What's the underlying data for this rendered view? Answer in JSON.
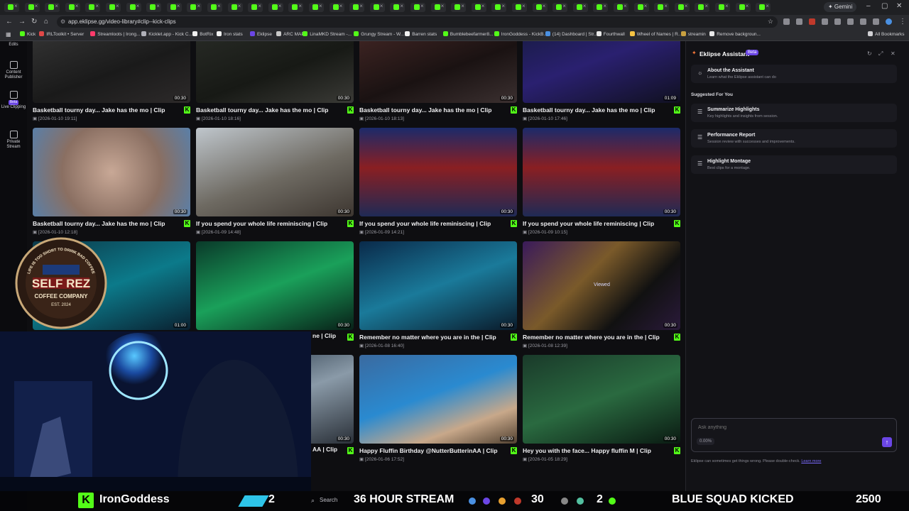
{
  "browser": {
    "tab_count": 38,
    "gemini_label": "✦ Gemini",
    "url": "app.eklipse.gg/video-library#clip--kick-clips",
    "bookmarks": [
      {
        "label": "Kick",
        "color": "#53fc18"
      },
      {
        "label": "IRLToolkit • Server",
        "color": "#e04848"
      },
      {
        "label": "Streamloots | Irong...",
        "color": "#ff3b6b"
      },
      {
        "label": "Kicklet.app - Kick C...",
        "color": "#b0b0b8"
      },
      {
        "label": "BotRix",
        "color": "#f0f0f0"
      },
      {
        "label": "Iron stats",
        "color": "#f0f0f0"
      },
      {
        "label": "Eklipse",
        "color": "#6b46e5"
      },
      {
        "label": "ARC MAP",
        "color": "#c8c8c8"
      },
      {
        "label": "LinaMKD Stream -...",
        "color": "#53fc18"
      },
      {
        "label": "Grungy Stream - W...",
        "color": "#53fc18"
      },
      {
        "label": "Barren stats",
        "color": "#f0f0f0"
      },
      {
        "label": "Bumblebeefarmer8...",
        "color": "#53fc18"
      },
      {
        "label": "IronGoddess - KickB...",
        "color": "#53fc18"
      },
      {
        "label": "(14) Dashboard | Str...",
        "color": "#4a90e2"
      },
      {
        "label": "Fourthwall",
        "color": "#e8e8e8"
      },
      {
        "label": "Wheel of Names | R...",
        "color": "#f6c343"
      },
      {
        "label": "streamin",
        "color": "#c8a040"
      },
      {
        "label": "Remove backgroun...",
        "color": "#e8e8e8"
      }
    ],
    "all_bookmarks": "All Bookmarks"
  },
  "leftnav": {
    "items": [
      {
        "label": "Edits",
        "icon": "edit-icon"
      },
      {
        "label": "Content Publisher",
        "icon": "calendar-icon"
      },
      {
        "label": "Live Clipping",
        "icon": "live-icon",
        "badge": "Beta"
      },
      {
        "label": "Private Stream",
        "icon": "video-icon"
      }
    ]
  },
  "clips": [
    {
      "title": "Basketball tourny day... Jake has the mo | Clip",
      "date": "[2026-01-10 19:11]",
      "duration": "00:30",
      "viewed": "",
      "bg": "linear-gradient(160deg,#3a3a3a,#1a1a1a 60%,#2d2a2a)"
    },
    {
      "title": "Basketball tourny day... Jake has the mo | Clip",
      "date": "[2026-01-10 18:16]",
      "duration": "00:30",
      "viewed": "",
      "bg": "linear-gradient(160deg,#2c2f2a,#171915 60%,#3a3a36)"
    },
    {
      "title": "Basketball tourny day... Jake has the mo | Clip",
      "date": "[2026-01-10 18:13]",
      "duration": "00:30",
      "viewed": "",
      "bg": "linear-gradient(160deg,#4a2a28,#1a1212 60%,#3b3030)"
    },
    {
      "title": "Basketball tourny day... Jake has the mo | Clip",
      "date": "[2026-01-10 17:46]",
      "duration": "01:09",
      "viewed": "",
      "bg": "linear-gradient(160deg,#141a3a,#2a2070 50%,#101020)"
    },
    {
      "title": "Basketball tourny day... Jake has the mo | Clip",
      "date": "[2026-01-10 12:18]",
      "duration": "00:30",
      "viewed": "",
      "bg": "radial-gradient(circle at 50% 50%,#c8a896,#8a6f62 55%,#5a7fa8)"
    },
    {
      "title": "If you spend your whole life reminiscing | Clip",
      "date": "[2026-01-09 14:48]",
      "duration": "00:30",
      "viewed": "",
      "bg": "linear-gradient(160deg,#bfc6cc,#6e6a62 55%,#3d3630)"
    },
    {
      "title": "If you spend your whole life reminiscing | Clip",
      "date": "[2026-01-09 14:21]",
      "duration": "00:30",
      "viewed": "",
      "bg": "linear-gradient(180deg,#1b2a6a,#8a1f22 45%,#1f2a55)"
    },
    {
      "title": "If you spend your whole life reminiscing | Clip",
      "date": "[2026-01-09 10:15]",
      "duration": "00:30",
      "viewed": "",
      "bg": "linear-gradient(180deg,#1b2a6a,#8a1f22 45%,#1f2a55)"
    },
    {
      "title": "",
      "date": "",
      "duration": "01:00",
      "viewed": "",
      "bg": "linear-gradient(160deg,#0c3a4a,#0c7a8a 50%,#0a2030)"
    },
    {
      "title": "",
      "date": "",
      "duration": "00:30",
      "viewed": "",
      "bg": "linear-gradient(160deg,#0a3a2a,#1aa05a 50%,#082018)"
    },
    {
      "title": "Remember no matter where you are in the | Clip",
      "date": "[2026-01-08 16:40]",
      "duration": "00:30",
      "viewed": "",
      "bg": "linear-gradient(160deg,#0a2a4a,#1a7a9a 50%,#0a1a2a)"
    },
    {
      "title": "Remember no matter where you are in the | Clip",
      "date": "[2026-01-08 12:39]",
      "duration": "00:30",
      "viewed": "Viewed",
      "bg": "linear-gradient(135deg,#3a1a5a,#7a5a2a 40%,#111 70%,#2a1a3a)"
    },
    {
      "title": "",
      "date": "",
      "duration": "00:30",
      "viewed": "",
      "bg": "linear-gradient(160deg,#1a2a3a,#8a9aa8 50%,#2a3038)"
    },
    {
      "title": "",
      "date": "",
      "duration": "00:30",
      "viewed": "",
      "bg": "linear-gradient(160deg,#1a2a3a,#8a9aa8 50%,#2a3038)"
    },
    {
      "title": "Happy Fluffin Birthday @NutterButterinAA | Clip",
      "date": "[2026-01-06 17:52]",
      "duration": "00:30",
      "viewed": "",
      "bg": "linear-gradient(160deg,#3a6aa0,#2a8ad0 45%,#c8a88a 75%,#504030)"
    },
    {
      "title": "Hey you with the face... Happy fluffin M | Clip",
      "date": "[2026-01-05 18:29]",
      "duration": "00:30",
      "viewed": "",
      "bg": "linear-gradient(160deg,#1a3a2a,#2a6a40 50%,#0a1a12)"
    }
  ],
  "partial_titles": [
    "ne | Clip",
    "AA | Clip"
  ],
  "assistant": {
    "title": "Eklipse Assistant",
    "badge": "Beta",
    "about_title": "About the Assistant",
    "about_sub": "Learn what the Eklipse assistant can do",
    "suggested_heading": "Suggested For You",
    "suggestions": [
      {
        "title": "Summarize Highlights",
        "sub": "Key highlights and insights from session."
      },
      {
        "title": "Performance Report",
        "sub": "Session review with successes and improvements."
      },
      {
        "title": "Highlight Montage",
        "sub": "Best clips for a montage."
      }
    ],
    "input_placeholder": "Ask anything",
    "usage": "0.00%",
    "disclaimer": "Eklipse can sometimes get things wrong. Please double-check.",
    "learn_more": "Learn more"
  },
  "overlay": {
    "logo_lines": [
      "SELF REZ",
      "COFFEE COMPANY",
      "EST. 2024"
    ],
    "logo_arc": "LIFE IS TOO SHORT TO DRINK BAD COFFEE",
    "streamer": "IronGoddess",
    "count_a": "2",
    "stream_title": "36 HOUR STREAM",
    "search_label": "Search",
    "count_b": "30",
    "count_c": "2",
    "kicked": "BLUE SQUAD KICKED",
    "goal": "2500"
  }
}
